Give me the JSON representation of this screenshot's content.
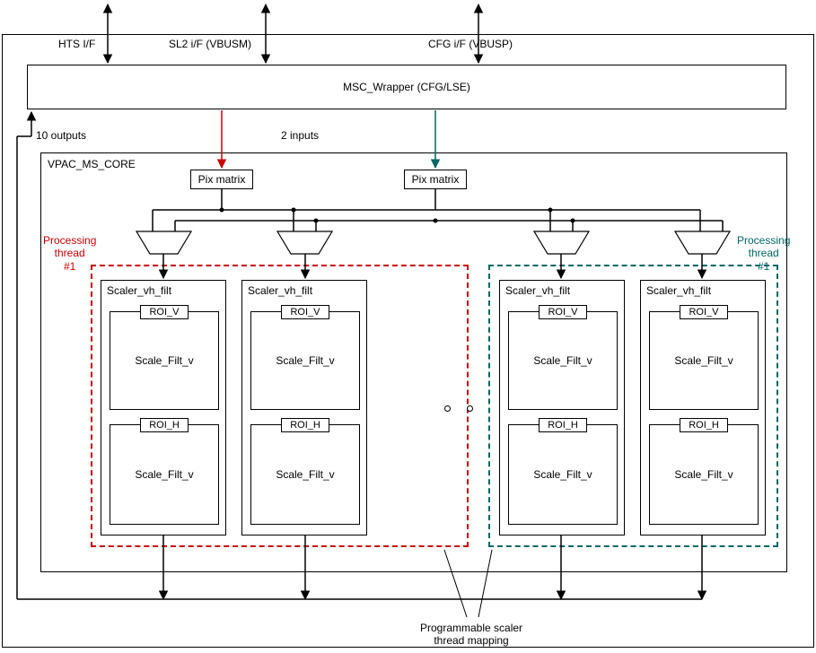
{
  "interfaces": {
    "hts": "HTS I/F",
    "sl2": "SL2 i/F (VBUSM)",
    "cfg": "CFG i/F (VBUSP)"
  },
  "wrapper": {
    "title": "MSC_Wrapper (CFG/LSE)"
  },
  "io": {
    "outputs": "10 outputs",
    "inputs": "2 inputs"
  },
  "core": {
    "title": "VPAC_MS_CORE",
    "pix_matrix": "Pix matrix",
    "proc_thread_1": "Processing\nthread\n#1",
    "proc_thread_2": "Processing\nthread\n#1"
  },
  "scaler": {
    "title": "Scaler_vh_filt",
    "roi_v": "ROI_V",
    "roi_h": "ROI_H",
    "scale_filt_v": "Scale_Filt_v"
  },
  "footer": {
    "caption": "Programmable scaler\nthread mapping"
  }
}
